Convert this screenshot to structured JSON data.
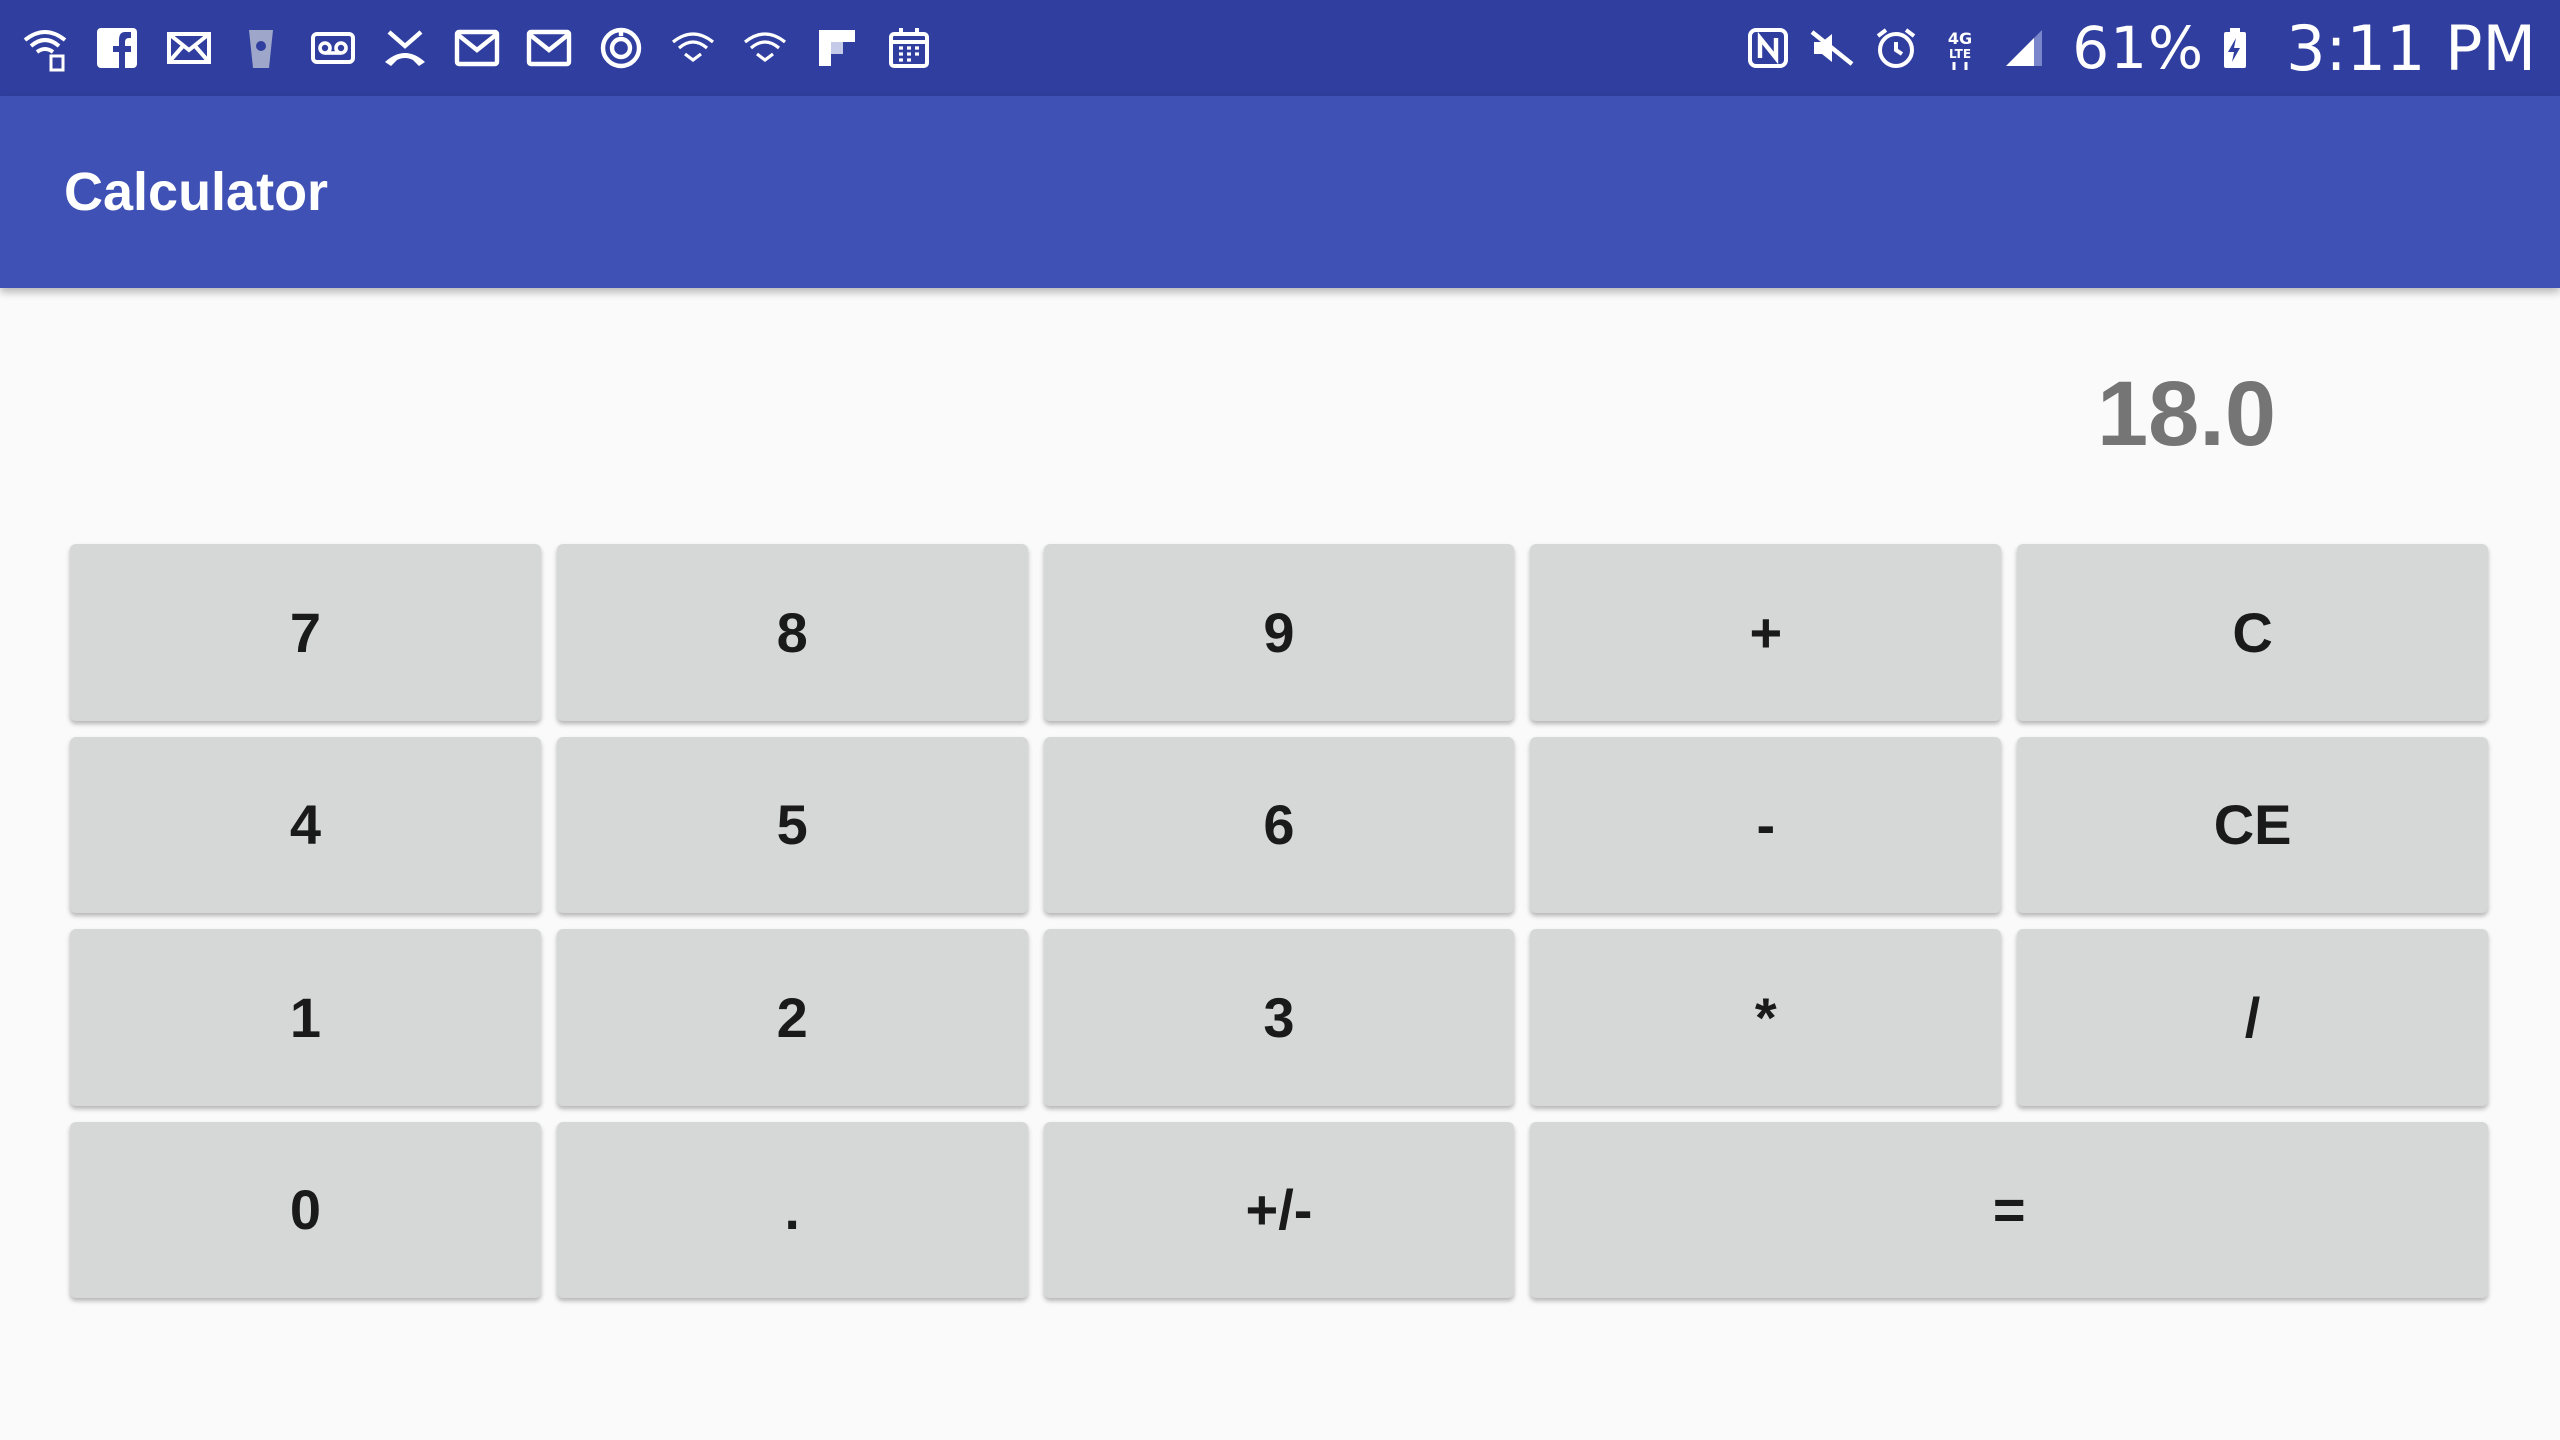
{
  "status_bar": {
    "left_icons": [
      "wifi-data-icon",
      "facebook-icon",
      "email-icon",
      "cup-icon",
      "voicemail-icon",
      "missed-call-icon",
      "gmail-icon",
      "gmail-icon",
      "sync-icon",
      "wifi-icon",
      "wifi-icon",
      "flipboard-icon",
      "calendar-icon"
    ],
    "right_icons": [
      "nfc-icon",
      "mute-icon",
      "alarm-icon",
      "4g-lte-icon",
      "signal-icon"
    ],
    "battery": "61%",
    "time": "3:11 PM"
  },
  "app_bar": {
    "title": "Calculator"
  },
  "display": {
    "value": "18.0"
  },
  "keypad": {
    "rows": [
      [
        {
          "label": "7",
          "name": "key-7"
        },
        {
          "label": "8",
          "name": "key-8"
        },
        {
          "label": "9",
          "name": "key-9"
        },
        {
          "label": "+",
          "name": "key-add"
        },
        {
          "label": "C",
          "name": "key-clear"
        }
      ],
      [
        {
          "label": "4",
          "name": "key-4"
        },
        {
          "label": "5",
          "name": "key-5"
        },
        {
          "label": "6",
          "name": "key-6"
        },
        {
          "label": "-",
          "name": "key-subtract"
        },
        {
          "label": "CE",
          "name": "key-clear-entry"
        }
      ],
      [
        {
          "label": "1",
          "name": "key-1"
        },
        {
          "label": "2",
          "name": "key-2"
        },
        {
          "label": "3",
          "name": "key-3"
        },
        {
          "label": "*",
          "name": "key-multiply"
        },
        {
          "label": "/",
          "name": "key-divide"
        }
      ],
      [
        {
          "label": "0",
          "name": "key-0"
        },
        {
          "label": ".",
          "name": "key-decimal"
        },
        {
          "label": "+/-",
          "name": "key-negate"
        },
        {
          "label": "=",
          "name": "key-equals"
        }
      ]
    ]
  },
  "colors": {
    "status_bar": "#303f9f",
    "app_bar": "#3f51b5",
    "background": "#fafafa",
    "key": "#d6d7d7",
    "display_text": "#757575"
  }
}
